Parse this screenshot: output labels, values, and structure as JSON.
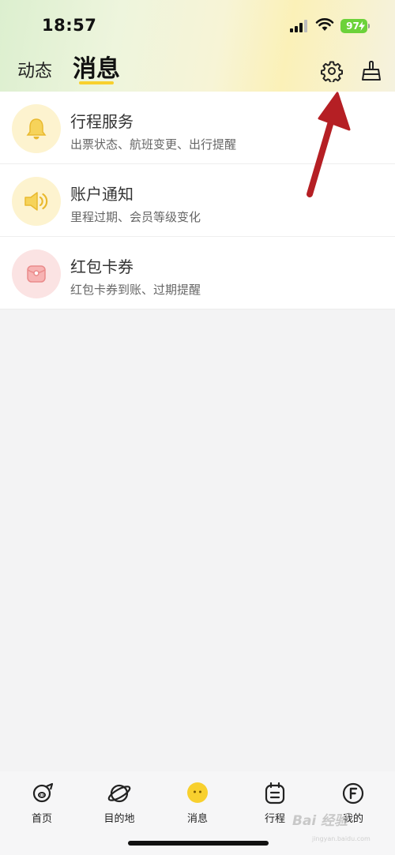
{
  "status_bar": {
    "time": "18:57",
    "battery": "97"
  },
  "header": {
    "tabs": [
      {
        "label": "动态",
        "active": false
      },
      {
        "label": "消息",
        "active": true
      }
    ],
    "accent_color": "#f8d02e"
  },
  "messages": [
    {
      "title": "行程服务",
      "subtitle": "出票状态、航班变更、出行提醒",
      "icon": "bell-icon"
    },
    {
      "title": "账户通知",
      "subtitle": "里程过期、会员等级变化",
      "icon": "speaker-icon"
    },
    {
      "title": "红包卡券",
      "subtitle": "红包卡券到账、过期提醒",
      "icon": "red-packet-icon"
    }
  ],
  "bottom_nav": [
    {
      "label": "首页",
      "icon": "pig-face-icon"
    },
    {
      "label": "目的地",
      "icon": "planet-icon"
    },
    {
      "label": "消息",
      "icon": "chat-bubble-icon",
      "active": true
    },
    {
      "label": "行程",
      "icon": "calendar-icon"
    },
    {
      "label": "我的",
      "icon": "profile-f-icon"
    }
  ],
  "watermark": {
    "text": "Bai 经验",
    "sub": "jingyan.baidu.com"
  }
}
